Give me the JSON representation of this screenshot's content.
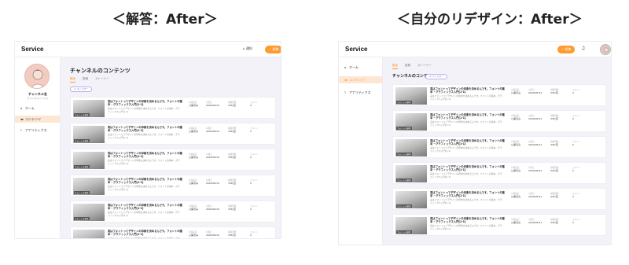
{
  "headings": {
    "left": "＜解答：After＞",
    "right": "＜自分のリデザイン：After＞"
  },
  "app": {
    "logo": "Service",
    "bell_label": "通知",
    "post_label": "投稿",
    "post_label_right": "投稿"
  },
  "sidebar": {
    "channel_name": "チャンネル名",
    "channel_sub": "チャンネルハンドル",
    "items": [
      {
        "icon": "⌂",
        "label": "ホーム"
      },
      {
        "icon": "▬",
        "label": "コンテンツ"
      },
      {
        "icon": "⌇",
        "label": "アナリティクス"
      }
    ]
  },
  "main": {
    "title": "チャンネルのコンテンツ",
    "tabs": [
      "動画",
      "投稿",
      "ストーリー"
    ],
    "filter_label": "フィルター"
  },
  "row_template": {
    "title": "実はフォントってデザインの印象を決めるんです。フォントの基本 - グラフィックス入門[1-1]",
    "desc": "実はフォントってデザインの印象を決めるんです。フォントの基本 - グラフィックス入門[1-1]",
    "thumb_tag": "フォントの基本",
    "labels": [
      "公開設定",
      "公開日",
      "視聴回数",
      "コメント"
    ],
    "values": [
      "公開済み",
      "2022/05/11",
      "336 回",
      "2"
    ]
  },
  "colors": {
    "accent": "#ff9a2e",
    "active_nav": "#fde7d4",
    "filter": "#7b72c9",
    "background": "#f3f2f8"
  }
}
